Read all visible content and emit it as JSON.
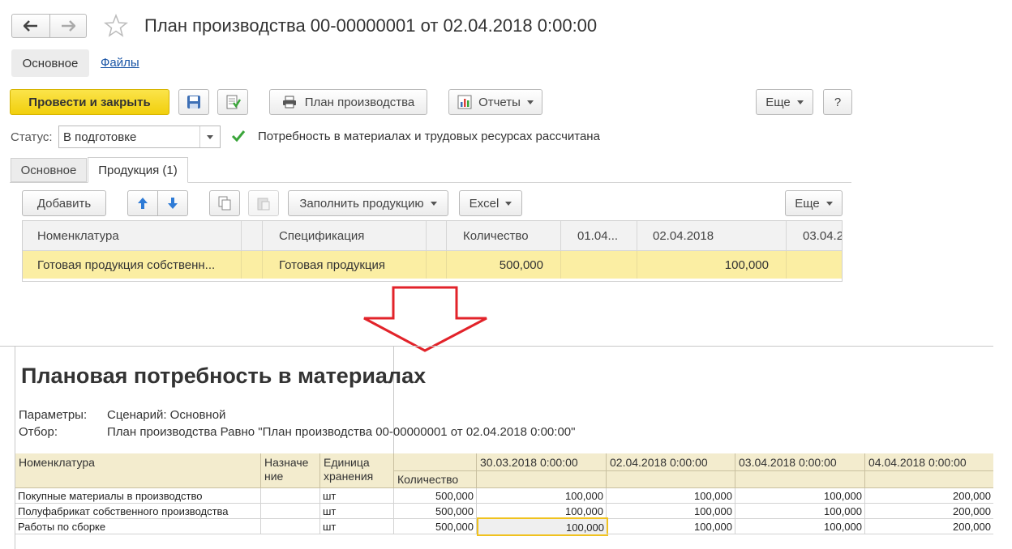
{
  "window": {
    "title": "План производства 00-00000001 от 02.04.2018 0:00:00",
    "form_tabs": [
      "Основное",
      "Файлы"
    ]
  },
  "toolbar": {
    "post_close": "Провести и закрыть",
    "plan_print": "План производства",
    "reports": "Отчеты",
    "more": "Еще",
    "help": "?"
  },
  "status": {
    "label": "Статус:",
    "value": "В подготовке",
    "message": "Потребность в материалах и трудовых ресурсах рассчитана"
  },
  "tabs": [
    "Основное",
    "Продукция (1)"
  ],
  "products_toolbar": {
    "add": "Добавить",
    "fill": "Заполнить продукцию",
    "excel": "Excel",
    "more": "Еще"
  },
  "products_table": {
    "columns": [
      "Номенклатура",
      "Спецификация",
      "Количество",
      "01.04...",
      "02.04.2018",
      "03.04.2"
    ],
    "rows": [
      {
        "item": "Готовая продукция собственн...",
        "spec": "Готовая продукция",
        "qty": "500,000",
        "d1": "",
        "d2": "100,000",
        "d3": ""
      }
    ]
  },
  "report": {
    "title": "Плановая потребность в материалах",
    "params_label": "Параметры:",
    "params_value": "Сценарий: Основной",
    "filter_label": "Отбор:",
    "filter_value": "План производства Равно \"План производства 00-00000001 от 02.04.2018 0:00:00\"",
    "headers": {
      "item": "Номенклатура",
      "purpose": "Назначе ние",
      "unit": "Единица хранения",
      "qty": "Количество",
      "dates": [
        "30.03.2018 0:00:00",
        "02.04.2018 0:00:00",
        "03.04.2018 0:00:00",
        "04.04.2018 0:00:00"
      ]
    },
    "rows": [
      {
        "item": "Покупные материалы в производство",
        "purpose": "",
        "unit": "шт",
        "qty": "500,000",
        "v": [
          "100,000",
          "100,000",
          "100,000",
          "200,000"
        ]
      },
      {
        "item": "Полуфабрикат собственного производства",
        "purpose": "",
        "unit": "шт",
        "qty": "500,000",
        "v": [
          "100,000",
          "100,000",
          "100,000",
          "200,000"
        ]
      },
      {
        "item": "Работы по сборке",
        "purpose": "",
        "unit": "шт",
        "qty": "500,000",
        "v": [
          "100,000",
          "100,000",
          "100,000",
          "200,000"
        ]
      }
    ]
  },
  "colors": {
    "primary_button": "#f5d81c",
    "selected_row": "#fbeea3",
    "report_header": "#f3ecce",
    "arrow": "#e2232a",
    "check": "#3aa53a"
  }
}
